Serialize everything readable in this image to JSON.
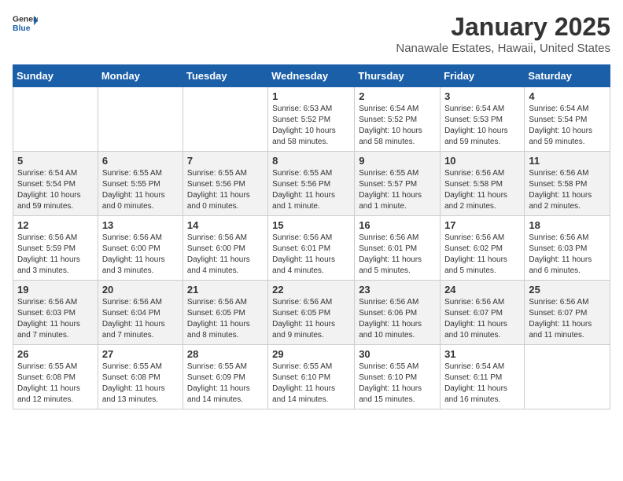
{
  "logo": {
    "general": "General",
    "blue": "Blue"
  },
  "title": "January 2025",
  "location": "Nanawale Estates, Hawaii, United States",
  "days_of_week": [
    "Sunday",
    "Monday",
    "Tuesday",
    "Wednesday",
    "Thursday",
    "Friday",
    "Saturday"
  ],
  "weeks": [
    [
      {
        "day": "",
        "info": ""
      },
      {
        "day": "",
        "info": ""
      },
      {
        "day": "",
        "info": ""
      },
      {
        "day": "1",
        "info": "Sunrise: 6:53 AM\nSunset: 5:52 PM\nDaylight: 10 hours\nand 58 minutes."
      },
      {
        "day": "2",
        "info": "Sunrise: 6:54 AM\nSunset: 5:52 PM\nDaylight: 10 hours\nand 58 minutes."
      },
      {
        "day": "3",
        "info": "Sunrise: 6:54 AM\nSunset: 5:53 PM\nDaylight: 10 hours\nand 59 minutes."
      },
      {
        "day": "4",
        "info": "Sunrise: 6:54 AM\nSunset: 5:54 PM\nDaylight: 10 hours\nand 59 minutes."
      }
    ],
    [
      {
        "day": "5",
        "info": "Sunrise: 6:54 AM\nSunset: 5:54 PM\nDaylight: 10 hours\nand 59 minutes."
      },
      {
        "day": "6",
        "info": "Sunrise: 6:55 AM\nSunset: 5:55 PM\nDaylight: 11 hours\nand 0 minutes."
      },
      {
        "day": "7",
        "info": "Sunrise: 6:55 AM\nSunset: 5:56 PM\nDaylight: 11 hours\nand 0 minutes."
      },
      {
        "day": "8",
        "info": "Sunrise: 6:55 AM\nSunset: 5:56 PM\nDaylight: 11 hours\nand 1 minute."
      },
      {
        "day": "9",
        "info": "Sunrise: 6:55 AM\nSunset: 5:57 PM\nDaylight: 11 hours\nand 1 minute."
      },
      {
        "day": "10",
        "info": "Sunrise: 6:56 AM\nSunset: 5:58 PM\nDaylight: 11 hours\nand 2 minutes."
      },
      {
        "day": "11",
        "info": "Sunrise: 6:56 AM\nSunset: 5:58 PM\nDaylight: 11 hours\nand 2 minutes."
      }
    ],
    [
      {
        "day": "12",
        "info": "Sunrise: 6:56 AM\nSunset: 5:59 PM\nDaylight: 11 hours\nand 3 minutes."
      },
      {
        "day": "13",
        "info": "Sunrise: 6:56 AM\nSunset: 6:00 PM\nDaylight: 11 hours\nand 3 minutes."
      },
      {
        "day": "14",
        "info": "Sunrise: 6:56 AM\nSunset: 6:00 PM\nDaylight: 11 hours\nand 4 minutes."
      },
      {
        "day": "15",
        "info": "Sunrise: 6:56 AM\nSunset: 6:01 PM\nDaylight: 11 hours\nand 4 minutes."
      },
      {
        "day": "16",
        "info": "Sunrise: 6:56 AM\nSunset: 6:01 PM\nDaylight: 11 hours\nand 5 minutes."
      },
      {
        "day": "17",
        "info": "Sunrise: 6:56 AM\nSunset: 6:02 PM\nDaylight: 11 hours\nand 5 minutes."
      },
      {
        "day": "18",
        "info": "Sunrise: 6:56 AM\nSunset: 6:03 PM\nDaylight: 11 hours\nand 6 minutes."
      }
    ],
    [
      {
        "day": "19",
        "info": "Sunrise: 6:56 AM\nSunset: 6:03 PM\nDaylight: 11 hours\nand 7 minutes."
      },
      {
        "day": "20",
        "info": "Sunrise: 6:56 AM\nSunset: 6:04 PM\nDaylight: 11 hours\nand 7 minutes."
      },
      {
        "day": "21",
        "info": "Sunrise: 6:56 AM\nSunset: 6:05 PM\nDaylight: 11 hours\nand 8 minutes."
      },
      {
        "day": "22",
        "info": "Sunrise: 6:56 AM\nSunset: 6:05 PM\nDaylight: 11 hours\nand 9 minutes."
      },
      {
        "day": "23",
        "info": "Sunrise: 6:56 AM\nSunset: 6:06 PM\nDaylight: 11 hours\nand 10 minutes."
      },
      {
        "day": "24",
        "info": "Sunrise: 6:56 AM\nSunset: 6:07 PM\nDaylight: 11 hours\nand 10 minutes."
      },
      {
        "day": "25",
        "info": "Sunrise: 6:56 AM\nSunset: 6:07 PM\nDaylight: 11 hours\nand 11 minutes."
      }
    ],
    [
      {
        "day": "26",
        "info": "Sunrise: 6:55 AM\nSunset: 6:08 PM\nDaylight: 11 hours\nand 12 minutes."
      },
      {
        "day": "27",
        "info": "Sunrise: 6:55 AM\nSunset: 6:08 PM\nDaylight: 11 hours\nand 13 minutes."
      },
      {
        "day": "28",
        "info": "Sunrise: 6:55 AM\nSunset: 6:09 PM\nDaylight: 11 hours\nand 14 minutes."
      },
      {
        "day": "29",
        "info": "Sunrise: 6:55 AM\nSunset: 6:10 PM\nDaylight: 11 hours\nand 14 minutes."
      },
      {
        "day": "30",
        "info": "Sunrise: 6:55 AM\nSunset: 6:10 PM\nDaylight: 11 hours\nand 15 minutes."
      },
      {
        "day": "31",
        "info": "Sunrise: 6:54 AM\nSunset: 6:11 PM\nDaylight: 11 hours\nand 16 minutes."
      },
      {
        "day": "",
        "info": ""
      }
    ]
  ]
}
